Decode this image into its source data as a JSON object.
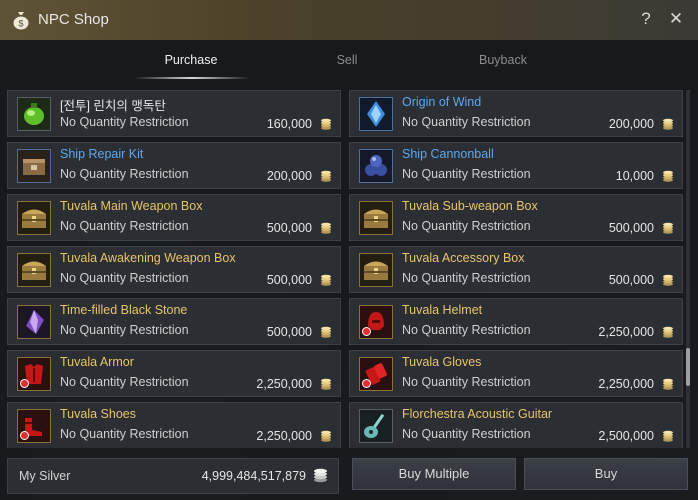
{
  "window": {
    "title": "NPC Shop",
    "help_label": "?",
    "close_label": "✕"
  },
  "tabs": [
    {
      "label": "Purchase",
      "active": true
    },
    {
      "label": "Sell",
      "active": false
    },
    {
      "label": "Buyback",
      "active": false
    }
  ],
  "items": [
    {
      "name": "[전투] 린치의 맹독탄",
      "restriction": "No Quantity Restriction",
      "price": "160,000",
      "icon": "green-potion-icon",
      "name_color": "white",
      "icon_frame": "grey"
    },
    {
      "name": "Origin of Wind",
      "restriction": "No Quantity Restriction",
      "price": "200,000",
      "icon": "blue-crystal-icon",
      "name_color": "blue",
      "icon_frame": "blue"
    },
    {
      "name": "Ship Repair Kit",
      "restriction": "No Quantity Restriction",
      "price": "200,000",
      "icon": "repair-kit-icon",
      "name_color": "blue",
      "icon_frame": "blue"
    },
    {
      "name": "Ship Cannonball",
      "restriction": "No Quantity Restriction",
      "price": "10,000",
      "icon": "cannonball-icon",
      "name_color": "blue",
      "icon_frame": "blue"
    },
    {
      "name": "Tuvala Main Weapon Box",
      "restriction": "No Quantity Restriction",
      "price": "500,000",
      "icon": "treasure-box-icon",
      "name_color": "gold",
      "icon_frame": "gold"
    },
    {
      "name": "Tuvala Sub-weapon Box",
      "restriction": "No Quantity Restriction",
      "price": "500,000",
      "icon": "treasure-box-icon",
      "name_color": "gold",
      "icon_frame": "gold"
    },
    {
      "name": "Tuvala Awakening Weapon Box",
      "restriction": "No Quantity Restriction",
      "price": "500,000",
      "icon": "treasure-box-icon",
      "name_color": "gold",
      "icon_frame": "gold"
    },
    {
      "name": "Tuvala Accessory Box",
      "restriction": "No Quantity Restriction",
      "price": "500,000",
      "icon": "treasure-box-icon",
      "name_color": "gold",
      "icon_frame": "gold"
    },
    {
      "name": "Time-filled Black Stone",
      "restriction": "No Quantity Restriction",
      "price": "500,000",
      "icon": "black-stone-icon",
      "name_color": "gold",
      "icon_frame": "gold"
    },
    {
      "name": "Tuvala Helmet",
      "restriction": "No Quantity Restriction",
      "price": "2,250,000",
      "icon": "helmet-icon",
      "name_color": "gold",
      "icon_frame": "gold",
      "restricted": true
    },
    {
      "name": "Tuvala Armor",
      "restriction": "No Quantity Restriction",
      "price": "2,250,000",
      "icon": "armor-icon",
      "name_color": "gold",
      "icon_frame": "gold",
      "restricted": true
    },
    {
      "name": "Tuvala Gloves",
      "restriction": "No Quantity Restriction",
      "price": "2,250,000",
      "icon": "gloves-icon",
      "name_color": "gold",
      "icon_frame": "gold",
      "restricted": true
    },
    {
      "name": "Tuvala Shoes",
      "restriction": "No Quantity Restriction",
      "price": "2,250,000",
      "icon": "shoes-icon",
      "name_color": "gold",
      "icon_frame": "gold",
      "restricted": true
    },
    {
      "name": "Florchestra Acoustic Guitar",
      "restriction": "No Quantity Restriction",
      "price": "2,500,000",
      "icon": "guitar-icon",
      "name_color": "gold",
      "icon_frame": "grey"
    }
  ],
  "footer": {
    "silver_label": "My Silver",
    "silver_value": "4,999,484,517,879",
    "buy_multiple_label": "Buy Multiple",
    "buy_label": "Buy"
  },
  "colors": {
    "gold_text": "#e9c46a",
    "blue_text": "#5aa9f2",
    "title_bar": "#5f5336"
  }
}
